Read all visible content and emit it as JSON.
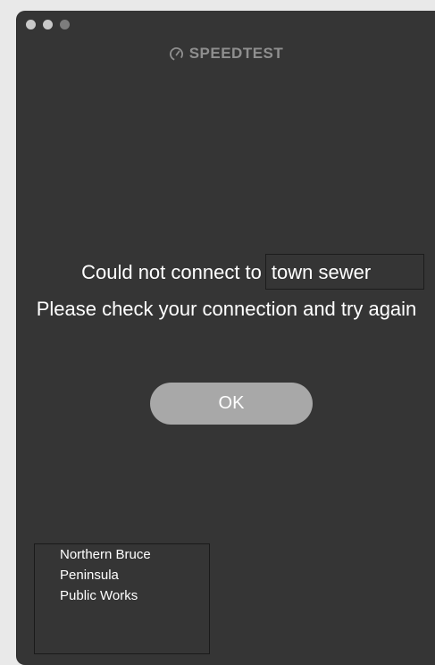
{
  "window": {
    "brand_name": "SPEEDTEST",
    "brand_icon": "speedometer-icon"
  },
  "error": {
    "prefix": "Could not connect to",
    "server_name": "town sewer",
    "detail": "Please check your connection and try again"
  },
  "actions": {
    "ok_label": "OK"
  },
  "provider": {
    "lines": [
      "Northern Bruce",
      "Peninsula",
      "Public Works"
    ]
  },
  "colors": {
    "window_bg": "#353535",
    "button_bg": "#a8a8a8",
    "brand_text": "#8f8f8f"
  }
}
